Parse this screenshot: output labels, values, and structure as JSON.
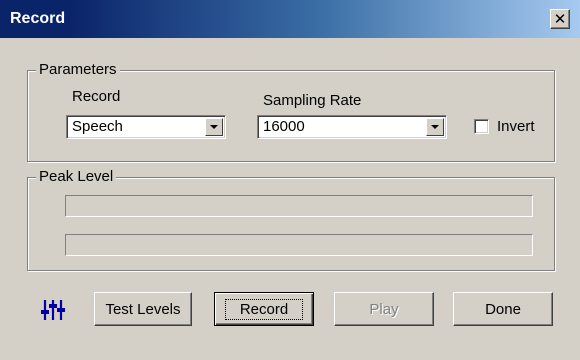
{
  "window": {
    "title": "Record",
    "close_glyph": "✕"
  },
  "parameters": {
    "legend": "Parameters",
    "record_label": "Record",
    "record_value": "Speech",
    "sampling_label": "Sampling Rate",
    "sampling_value": "16000",
    "invert_label": "Invert",
    "invert_checked": false
  },
  "peak": {
    "legend": "Peak Level",
    "meter1_level": 0,
    "meter2_level": 0
  },
  "buttons": {
    "mixer_icon": "mixer-sliders-icon",
    "test_levels": "Test Levels",
    "record": "Record",
    "play": "Play",
    "done": "Done"
  },
  "colors": {
    "title_start": "#0a246a",
    "title_end": "#a6caf0",
    "face": "#d4d0c8",
    "icon_blue": "#0000a8"
  }
}
